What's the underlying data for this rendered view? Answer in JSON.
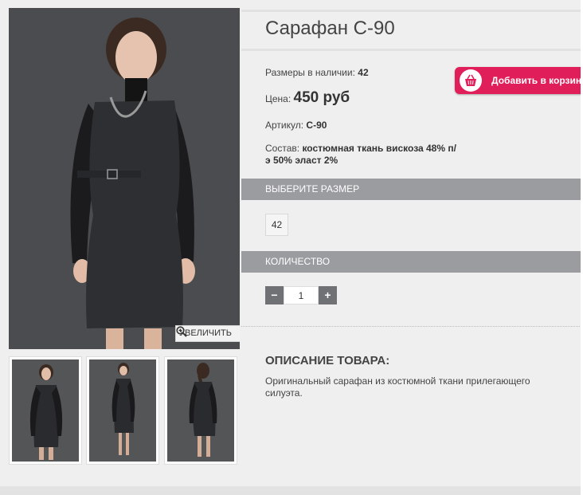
{
  "product": {
    "title": "Сарафан С-90",
    "sizes_label": "Размеры в наличии:",
    "sizes_value": "42",
    "price_label": "Цена:",
    "price_value": "450 руб",
    "sku_label": "Артикул:",
    "sku_value": "С-90",
    "composition_label": "Состав:",
    "composition_value": "костюмная ткань вискоза 48% п/э 50% эласт 2%"
  },
  "cart_button": {
    "label": "Добавить в корзину",
    "icon": "basket-icon",
    "color": "#e01f5a"
  },
  "gallery": {
    "zoom_label": "УВЕЛИЧИТЬ",
    "zoom_icon": "magnifier-plus-icon"
  },
  "size_section": {
    "title": "ВЫБЕРИТЕ РАЗМЕР",
    "options": [
      "42"
    ]
  },
  "quantity_section": {
    "title": "КОЛИЧЕСТВО",
    "value": "1",
    "minus": "−",
    "plus": "+"
  },
  "description": {
    "title": "ОПИСАНИЕ ТОВАРА:",
    "text": "Оригинальный сарафан из костюмной ткани прилегающего силуэта."
  },
  "colors": {
    "accent": "#e01f5a",
    "section_bar": "#9a9c9f",
    "background": "#efefef"
  }
}
